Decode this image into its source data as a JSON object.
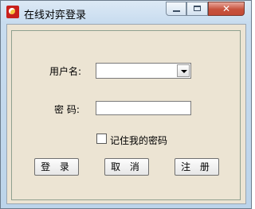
{
  "window": {
    "title": "在线对弈登录",
    "controls": {
      "minimize": "minimize",
      "maximize": "maximize",
      "close": "✕"
    }
  },
  "form": {
    "username_label": "用户名:",
    "username_value": "",
    "password_label": "密 码:",
    "password_value": "",
    "remember_label": "记住我的密码",
    "remember_checked": false
  },
  "buttons": {
    "login": "登 录",
    "cancel": "取 消",
    "register": "注 册"
  },
  "icons": [
    "app-icon",
    "minimize-icon",
    "maximize-icon",
    "close-icon",
    "dropdown-arrow-icon"
  ],
  "colors": {
    "client_bg": "#ece4d3",
    "close_button": "#c7523d",
    "groupbox_border": "#8fa08f"
  }
}
